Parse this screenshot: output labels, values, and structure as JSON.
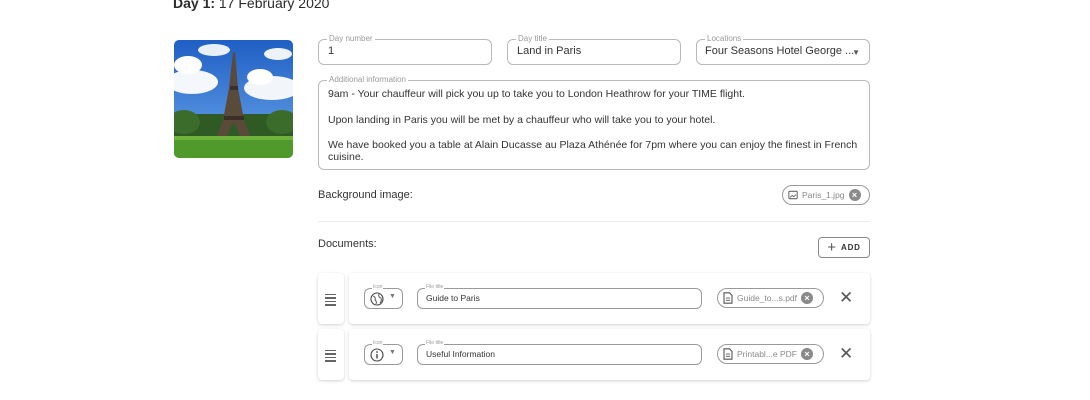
{
  "day_heading": {
    "prefix": "Day 1:",
    "date": "17 February 2020"
  },
  "photo": {
    "description_icon": "eiffel-tower-photo"
  },
  "fields": {
    "day_number": {
      "legend": "Day number",
      "value": "1"
    },
    "day_title": {
      "legend": "Day title",
      "value": "Land in Paris"
    },
    "locations": {
      "legend": "Locations",
      "value": "Four Seasons Hotel George ..."
    },
    "additional_info": {
      "legend": "Additional information",
      "paragraphs": [
        "9am - Your chauffeur will pick you up to take you to London Heathrow for your TIME flight.",
        "Upon landing in Paris you will be met by a chauffeur who will take you to your hotel.",
        "We have booked you a table at Alain Ducasse au Plaza Athénée for 7pm where you can enjoy the finest in French cuisine."
      ]
    }
  },
  "background_image": {
    "label": "Background image:",
    "file": "Paris_1.jpg",
    "icon": "image-icon"
  },
  "documents": {
    "label": "Documents:",
    "add_label": "ADD",
    "rows": [
      {
        "icon_legend": "Icon",
        "icon": "globe-icon",
        "title_legend": "File title",
        "title": "Guide to Paris",
        "file": "Guide_to...s.pdf"
      },
      {
        "icon_legend": "Icon",
        "icon": "info-icon",
        "title_legend": "File title",
        "title": "Useful Information",
        "file": "Printabl...e PDF"
      }
    ]
  },
  "colors": {
    "border": "#b9b9b9",
    "text": "#333333",
    "chip_border": "#9a9a9a"
  }
}
